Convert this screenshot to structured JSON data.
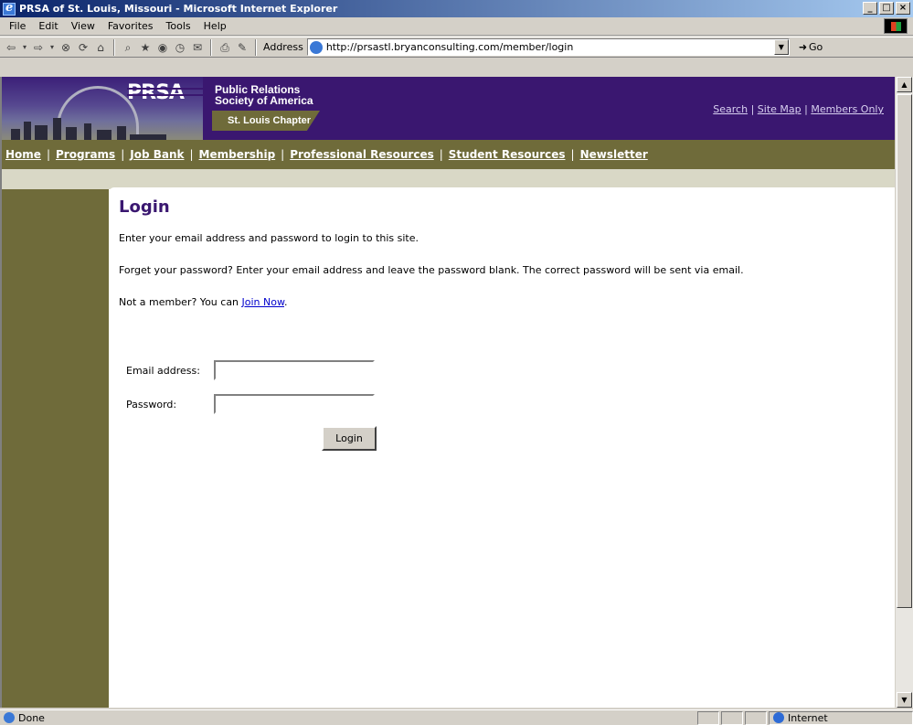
{
  "window": {
    "title": "PRSA of St. Louis, Missouri - Microsoft Internet Explorer",
    "minimize": "_",
    "maximize": "□",
    "close": "×"
  },
  "menu": [
    "File",
    "Edit",
    "View",
    "Favorites",
    "Tools",
    "Help"
  ],
  "toolbar": {
    "address_label": "Address",
    "url": "http://prsastl.bryanconsulting.com/member/login",
    "go_label": "Go",
    "icons": [
      "back-icon",
      "forward-icon",
      "stop-icon",
      "refresh-icon",
      "home-icon",
      "search-icon",
      "favorites-icon",
      "media-icon",
      "history-icon",
      "mail-icon",
      "print-icon",
      "edit-icon"
    ]
  },
  "header": {
    "logo": "PRSA",
    "org_line1": "Public Relations",
    "org_line2": "Society of America",
    "chapter": "St. Louis Chapter",
    "links": [
      "Search",
      "Site Map",
      "Members Only"
    ]
  },
  "nav": [
    "Home",
    "Programs",
    "Job Bank",
    "Membership",
    "Professional Resources",
    "Student Resources",
    "Newsletter"
  ],
  "content": {
    "title": "Login",
    "p1": "Enter your email address and password to login to this site.",
    "p2": "Forget your password? Enter your email address and leave the password blank. The correct password will be sent via email.",
    "p3_prefix": "Not a member? You can ",
    "p3_link": "Join Now",
    "p3_suffix": ".",
    "email_label": "Email address:",
    "password_label": "Password:",
    "email_value": "",
    "password_value": "",
    "login_button": "Login"
  },
  "status": {
    "text": "Done",
    "zone": "Internet"
  }
}
